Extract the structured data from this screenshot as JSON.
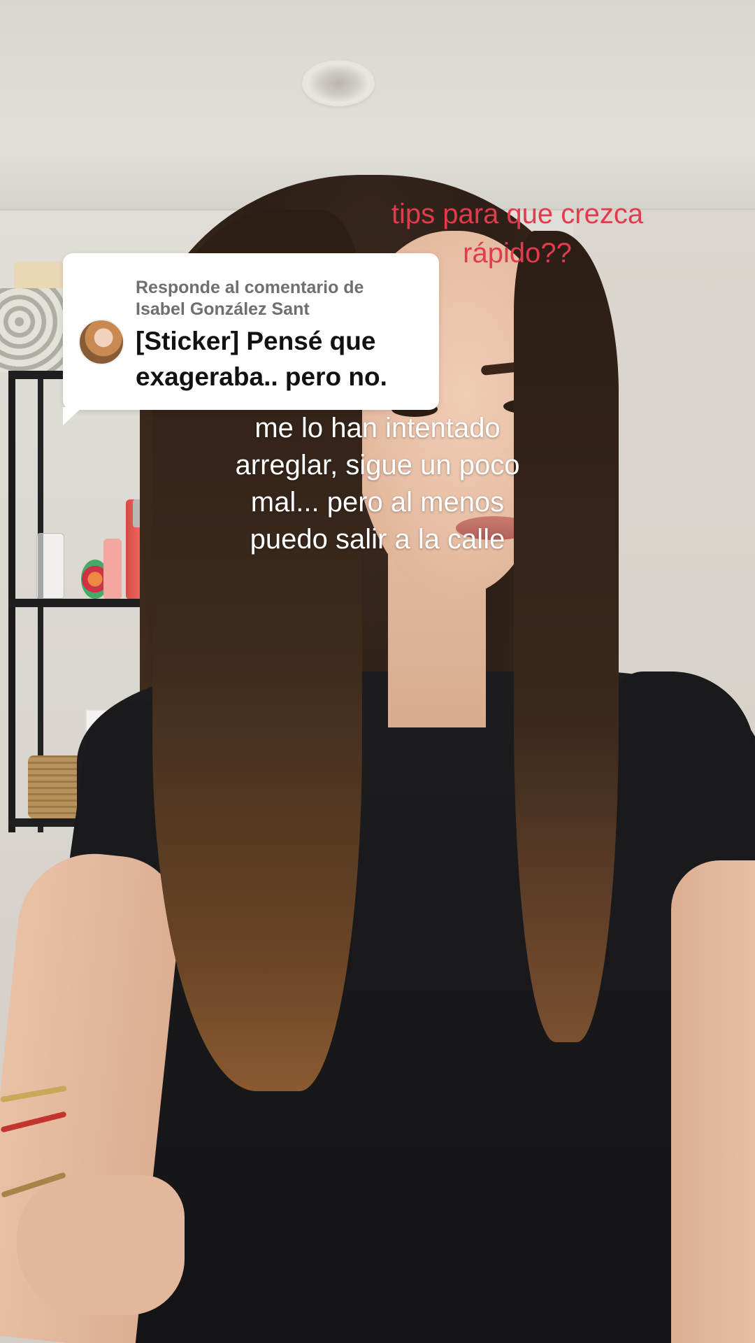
{
  "reply_card": {
    "header_line1": "Responde al comentario de",
    "header_line2": "Isabel González Sant",
    "comment_line1": "[Sticker] Pensé que",
    "comment_line2": "exageraba.. pero no."
  },
  "red_caption": {
    "line1": "tips para que crezca",
    "line2": "rápido??",
    "color": "#e33a4e"
  },
  "white_caption": {
    "line1": "me lo han intentado",
    "line2": "arreglar, sigue un poco",
    "line3": "mal... pero al menos",
    "line4": "puedo salir a la calle"
  }
}
